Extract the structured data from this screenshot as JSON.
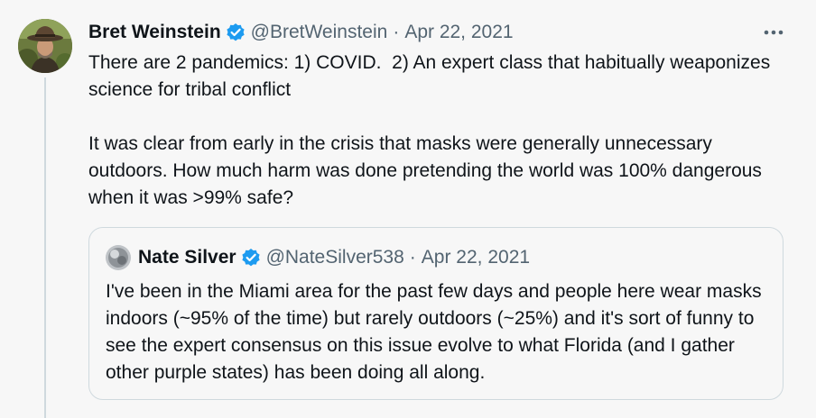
{
  "tweet": {
    "author_name": "Bret Weinstein",
    "handle": "@BretWeinstein",
    "separator": "·",
    "date": "Apr 22, 2021",
    "more_label": "•••",
    "paragraph_1": "There are 2 pandemics: 1) COVID.  2) An expert class that habitually weaponizes science for tribal conflict",
    "paragraph_2": "It was clear from early in the crisis that masks were generally unnecessary outdoors. How much harm was done pretending the world was 100% dangerous when it was >99% safe?",
    "avatar_icon": "avatar-photo-icon",
    "verified_icon": "verified-badge-icon"
  },
  "quote": {
    "author_name": "Nate Silver",
    "handle": "@NateSilver538",
    "separator": "·",
    "date": "Apr 22, 2021",
    "text": "I've been in the Miami area for the past few days and people here wear masks indoors (~95% of the time) but rarely outdoors (~25%) and it's sort of funny to see the expert consensus on this issue evolve to what Florida (and I gather other purple states) has been doing all along.",
    "avatar_icon": "avatar-photo-icon",
    "verified_icon": "verified-badge-icon"
  },
  "colors": {
    "background": "#f7f7f7",
    "text": "#0f1419",
    "secondary_text": "#536471",
    "verified_blue": "#1d9bf0",
    "border": "#cfd9de"
  }
}
